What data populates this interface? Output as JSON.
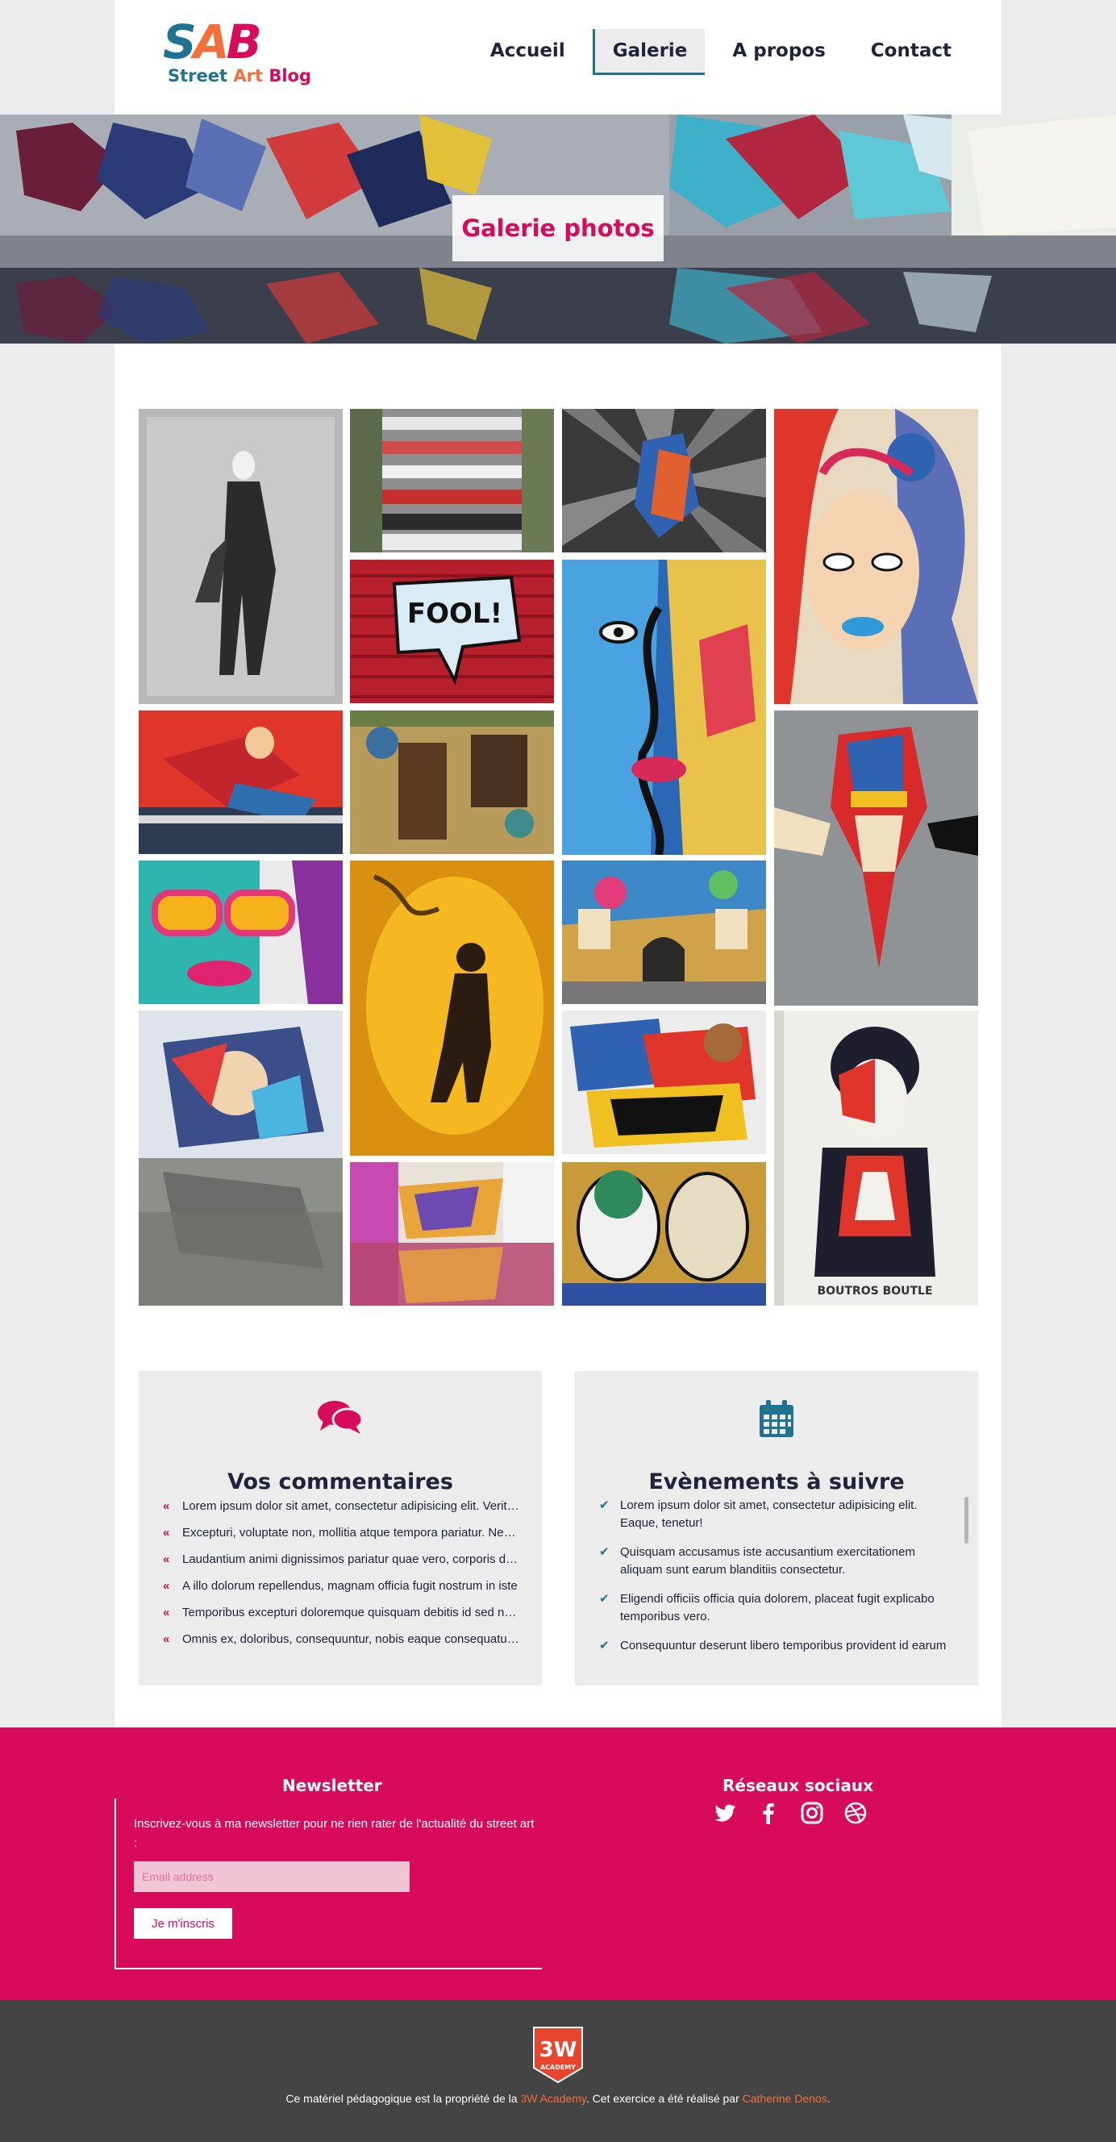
{
  "brand": {
    "letters": [
      "S",
      "A",
      "B"
    ],
    "words": [
      "Street",
      "Art",
      "Blog"
    ]
  },
  "nav": [
    {
      "label": "Accueil",
      "active": false
    },
    {
      "label": "Galerie",
      "active": true
    },
    {
      "label": "A propos",
      "active": false
    },
    {
      "label": "Contact",
      "active": false
    }
  ],
  "banner": {
    "title": "Galerie photos"
  },
  "gallery": {
    "photo_texts": {
      "fool": "FOOL!",
      "stencil_caption": "BOUTROS BOUTLE"
    }
  },
  "comments": {
    "title": "Vos commentaires",
    "icon": "comments-icon",
    "items": [
      "Lorem ipsum dolor sit amet, consectetur adipisicing elit. Veritatis",
      "Excepturi, voluptate non, mollitia atque tempora pariatur. Nemo",
      "Laudantium animi dignissimos pariatur quae vero, corporis dolor",
      "A illo dolorum repellendus, magnam officia fugit nostrum in iste",
      "Temporibus excepturi doloremque quisquam debitis id sed nemo",
      "Omnis ex, doloribus, consequuntur, nobis eaque consequatur amet"
    ]
  },
  "events": {
    "title": "Evènements à suivre",
    "icon": "calendar-icon",
    "items": [
      "Lorem ipsum dolor sit amet, consectetur adipisicing elit. Eaque, tenetur!",
      "Quisquam accusamus iste accusantium exercitationem aliquam sunt earum blanditiis consectetur.",
      "Eligendi officiis officia quia dolorem, placeat fugit explicabo temporibus vero.",
      "Consequuntur deserunt libero temporibus provident id earum"
    ]
  },
  "newsletter": {
    "title": "Newsletter",
    "text": "Inscrivez-vous à ma newsletter pour ne rien rater de l'actualité du street art :",
    "placeholder": "Email address",
    "button": "Je m'inscris"
  },
  "social": {
    "title": "Réseaux sociaux",
    "icons": [
      "twitter-icon",
      "facebook-icon",
      "instagram-icon",
      "dribbble-icon"
    ]
  },
  "footer": {
    "logo_text": "3W",
    "logo_sub": "ACADEMY",
    "text_before": "Ce matériel pédagogique est la propriété de la ",
    "link1": "3W Academy",
    "text_middle": ". Cet exercice a été réalisé par ",
    "link2": "Catherine Denos",
    "text_after": "."
  },
  "colors": {
    "accent": "#d80a5a",
    "teal": "#1f7290",
    "dark": "#22223a",
    "footer": "#444444"
  }
}
